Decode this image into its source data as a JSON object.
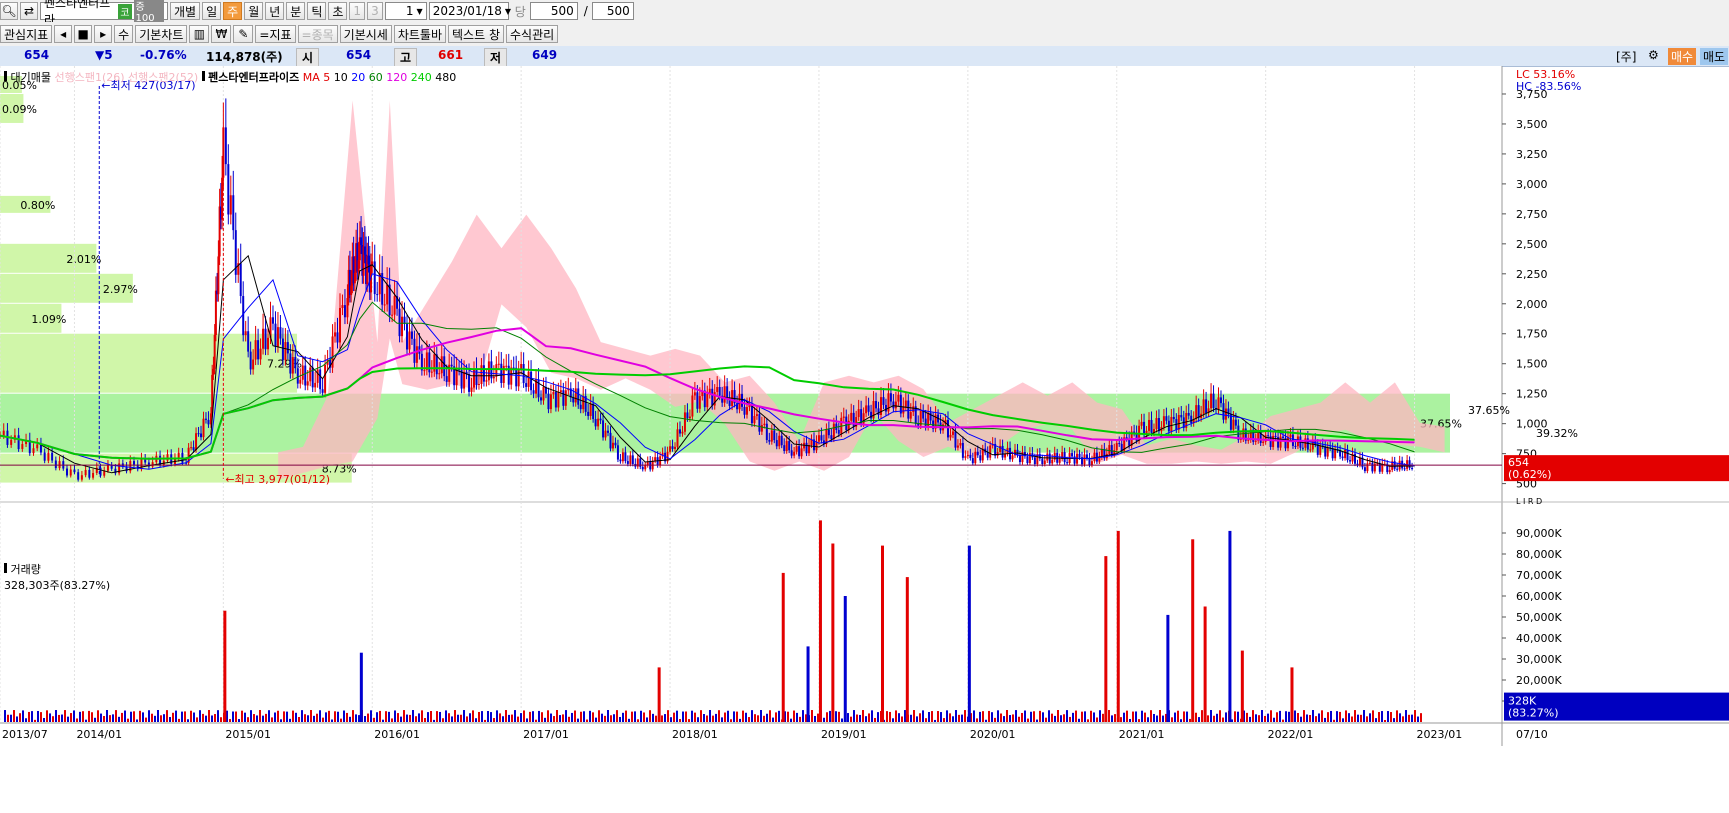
{
  "toolbar1": {
    "stock_name": "펜스타엔터프라",
    "market_badge": "코",
    "margin_badge": "증100",
    "individual": "개별",
    "periods": [
      "일",
      "주",
      "월",
      "년",
      "분",
      "틱",
      "초"
    ],
    "active_period": "주",
    "n1": "1",
    "n3": "3",
    "unit": "1",
    "date": "2023/01/18",
    "dang": "당",
    "count1": "500",
    "slash": "/",
    "count2": "500"
  },
  "toolbar2": {
    "interest": "관심지표",
    "su": "수",
    "basic_chart": "기본차트",
    "indicator": "=지표",
    "item": "=종목",
    "basic_quote": "기본시세",
    "chart_toolbar": "차트툴바",
    "text": "텍스트 창",
    "formula": "수식관리"
  },
  "info": {
    "price": "654",
    "change": "▼5",
    "rate": "-0.76%",
    "volume": "114,878(주)",
    "open_label": "시",
    "open": "654",
    "high_label": "고",
    "high": "661",
    "low_label": "저",
    "low": "649",
    "unit_btn": "[주]",
    "buy": "매수",
    "sell": "매도"
  },
  "colors": {
    "up": "#e30000",
    "down": "#0000d0",
    "ma5": "#e30000",
    "ma10": "#000000",
    "ma20": "#0000ff",
    "ma60": "#008000",
    "ma120": "#e000e0",
    "ma240": "#00cc00",
    "cloud": "#ffb6c1",
    "profile": "#c8f59a"
  },
  "chart_data": [
    {
      "type": "line",
      "title": "펜스타엔터프라이즈",
      "legend_left": "대기매물",
      "legend_faded": [
        "선행스팬1(26)",
        "선행스팬2(52)"
      ],
      "ma_label": "MA",
      "ma_periods": [
        "5",
        "10",
        "20",
        "60",
        "120",
        "240",
        "480"
      ],
      "x_ticks": [
        "2013/07",
        "2014/01",
        "2015/01",
        "2016/01",
        "2017/01",
        "2018/01",
        "2019/01",
        "2020/01",
        "2021/01",
        "2022/01",
        "2023/01"
      ],
      "x_end_label": "07/10",
      "y_ticks": [
        "3,750",
        "3,500",
        "3,250",
        "3,000",
        "2,750",
        "2,500",
        "2,250",
        "2,000",
        "1,750",
        "1,500",
        "1,250",
        "1,000",
        "750",
        "500"
      ],
      "ylim": [
        480,
        3900
      ],
      "lc_label": "LC  53.16%",
      "hc_label": "HC -83.56%",
      "lir_label": "L I R D",
      "current_price_tag": "654",
      "current_price_pct": "(0.62%)",
      "annotations": {
        "low": "←최저 427(03/17)",
        "high": "←최고 3,977(01/12)"
      },
      "volume_profile": [
        {
          "range": [
            3750,
            3900
          ],
          "pct": "0.05%"
        },
        {
          "range": [
            3500,
            3750
          ],
          "pct": "0.09%"
        },
        {
          "range": [
            2750,
            2900
          ],
          "pct": "0.80%"
        },
        {
          "range": [
            2250,
            2500
          ],
          "pct": "2.01%"
        },
        {
          "range": [
            2000,
            2250
          ],
          "pct": "2.97%"
        },
        {
          "range": [
            1750,
            2000
          ],
          "pct": "1.09%"
        },
        {
          "range": [
            1250,
            1750
          ],
          "pct": "7.29%"
        },
        {
          "range": [
            750,
            1250
          ],
          "pct": "37.65%"
        },
        {
          "range": [
            500,
            750
          ],
          "pct": "8.73%"
        }
      ],
      "profile_pct_right": [
        "37.65%",
        "39.32%"
      ],
      "price_series_x": [
        "2013/07",
        "2013/10",
        "2014/01",
        "2014/04",
        "2014/07",
        "2014/10",
        "2014/12",
        "2015/01",
        "2015/03",
        "2015/05",
        "2015/07",
        "2015/09",
        "2015/11",
        "2015/12",
        "2016/01",
        "2016/03",
        "2016/05",
        "2016/07",
        "2016/09",
        "2016/11",
        "2017/01",
        "2017/03",
        "2017/05",
        "2017/07",
        "2017/09",
        "2017/11",
        "2018/01",
        "2018/03",
        "2018/05",
        "2018/07",
        "2018/09",
        "2018/11",
        "2019/01",
        "2019/03",
        "2019/05",
        "2019/07",
        "2019/09",
        "2019/11",
        "2020/01",
        "2020/03",
        "2020/05",
        "2020/07",
        "2020/09",
        "2020/11",
        "2021/01",
        "2021/03",
        "2021/05",
        "2021/07",
        "2021/09",
        "2021/11",
        "2022/01",
        "2022/03",
        "2022/05",
        "2022/07",
        "2022/09",
        "2022/11",
        "2023/01"
      ],
      "close": [
        900,
        780,
        560,
        620,
        680,
        720,
        1100,
        3300,
        1500,
        1800,
        1400,
        1350,
        2100,
        2450,
        2200,
        1900,
        1500,
        1450,
        1350,
        1450,
        1400,
        1200,
        1250,
        1050,
        720,
        640,
        760,
        1200,
        1250,
        1150,
        900,
        760,
        850,
        1000,
        1100,
        1200,
        1050,
        1000,
        700,
        780,
        730,
        700,
        720,
        700,
        800,
        950,
        1000,
        1050,
        1200,
        900,
        870,
        850,
        800,
        750,
        650,
        640,
        654
      ],
      "volume_ylim": [
        0,
        100000
      ],
      "volume_ticks": [
        "90,000K",
        "80,000K",
        "70,000K",
        "60,000K",
        "50,000K",
        "40,000K",
        "30,000K",
        "20,000K",
        "10,000K"
      ],
      "volume_label": "거래량",
      "volume_value": "328,303주(83.27%)",
      "volume_tag": "328K",
      "volume_tag_pct": "(83.27%)",
      "volume_spikes": [
        {
          "x": "2015/01",
          "value": 53000
        },
        {
          "x": "2015/12",
          "value": 33000
        },
        {
          "x": "2017/12",
          "value": 26000
        },
        {
          "x": "2018/10",
          "value": 71000
        },
        {
          "x": "2018/12",
          "value": 36000
        },
        {
          "x": "2019/01",
          "value": 96000
        },
        {
          "x": "2019/02",
          "value": 85000
        },
        {
          "x": "2019/03",
          "value": 60000
        },
        {
          "x": "2019/06",
          "value": 84000
        },
        {
          "x": "2019/08",
          "value": 69000
        },
        {
          "x": "2020/01",
          "value": 84000
        },
        {
          "x": "2020/12",
          "value": 79000
        },
        {
          "x": "2021/01",
          "value": 91000
        },
        {
          "x": "2021/05",
          "value": 51000
        },
        {
          "x": "2021/07",
          "value": 87000
        },
        {
          "x": "2021/08",
          "value": 55000
        },
        {
          "x": "2021/10",
          "value": 91000
        },
        {
          "x": "2021/11",
          "value": 34000
        },
        {
          "x": "2022/03",
          "value": 26000
        }
      ]
    }
  ]
}
